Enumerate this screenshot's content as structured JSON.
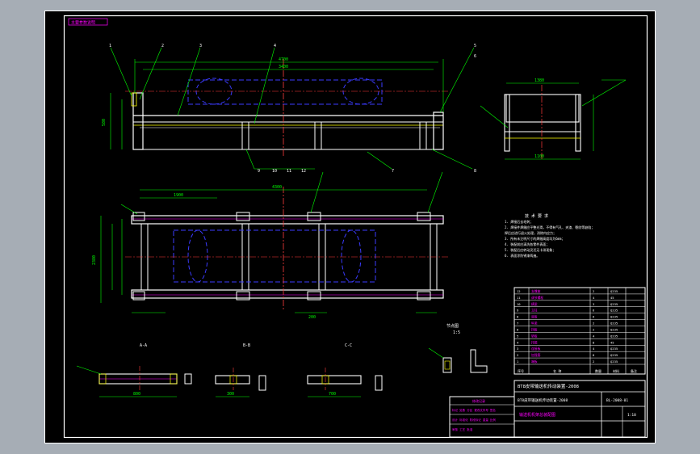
{
  "drawing": {
    "tag_label": "主要参数说明",
    "view_labels": [
      "A-A",
      "B-B",
      "C-C"
    ],
    "detail_label": "节点图",
    "detail_scale": "1:5",
    "front_dims": {
      "overall_length": "4700",
      "inner_length": "3400",
      "height": "580",
      "side_height": "380"
    },
    "plan_dims": {
      "main_span": "4300",
      "width": "2380",
      "inner_width": "1900",
      "col_width": "200"
    },
    "side_dims": {
      "width": "1380",
      "base": "1100"
    },
    "section_dims": {
      "a": "800",
      "b": "300",
      "c": "700"
    },
    "balloons": [
      "1",
      "2",
      "3",
      "4",
      "5",
      "6",
      "7",
      "8",
      "9",
      "10",
      "11",
      "12"
    ],
    "notes": {
      "title": "技 术 要 求",
      "lines": [
        "1. 焊接后去毛刺；",
        "2. 焊接件焊缝应平整光滑，不得有气孔、夹渣、裂纹等缺陷；",
        "   焊后应进行退火处理，消除内应力；",
        "3. 所有未注明尺寸的焊缝高度均为6mm；",
        "4. 装配前应清洗各零件表面；",
        "5. 装配后应转动灵活无卡滞现象；",
        "6. 表面涂防锈漆两遍。"
      ]
    },
    "bom_rows": [
      [
        "12",
        "支撑座",
        "2",
        "Q235",
        ""
      ],
      [
        "11",
        "调节螺栓",
        "4",
        "45",
        ""
      ],
      [
        "10",
        "横梁",
        "3",
        "Q235",
        ""
      ],
      [
        "9",
        "立柱",
        "6",
        "Q235",
        ""
      ],
      [
        "8",
        "底板",
        "6",
        "Q235",
        ""
      ],
      [
        "7",
        "纵梁",
        "2",
        "Q235",
        ""
      ],
      [
        "6",
        "挡板",
        "2",
        "Q235",
        ""
      ],
      [
        "5",
        "垫板",
        "4",
        "Q235",
        ""
      ],
      [
        "4",
        "托辊",
        "8",
        "45",
        ""
      ],
      [
        "3",
        "连接板",
        "4",
        "Q235",
        ""
      ],
      [
        "2",
        "加强筋",
        "8",
        "Q235",
        ""
      ],
      [
        "1",
        "端板",
        "2",
        "Q235",
        ""
      ]
    ],
    "bom_header": [
      "序号",
      "名 称",
      "数量",
      "材料",
      "备注"
    ],
    "title_block": {
      "project": "BT8皮带输送机传动装置-2008",
      "drawing_no": "BL-2008-01",
      "part_name": "输送机机架总装配图",
      "scale": "1:10"
    },
    "revision_block": {
      "title": "修改记录",
      "lines": [
        "标记 处数 分区 更改文件号 签名",
        "设计  标准化  阶段标记 重量 比例",
        "审核  工艺  批准"
      ]
    }
  },
  "colors": {
    "background": "#a6adb5",
    "sheet": "#000000",
    "frame": "#ffffff",
    "outline": "#ffffff",
    "dim": "#00ff00",
    "hidden": "#3b3bff",
    "center": "#ff3b3b",
    "magenta": "#ff00ff",
    "yellow": "#ffff00",
    "cyan": "#00ffff"
  }
}
